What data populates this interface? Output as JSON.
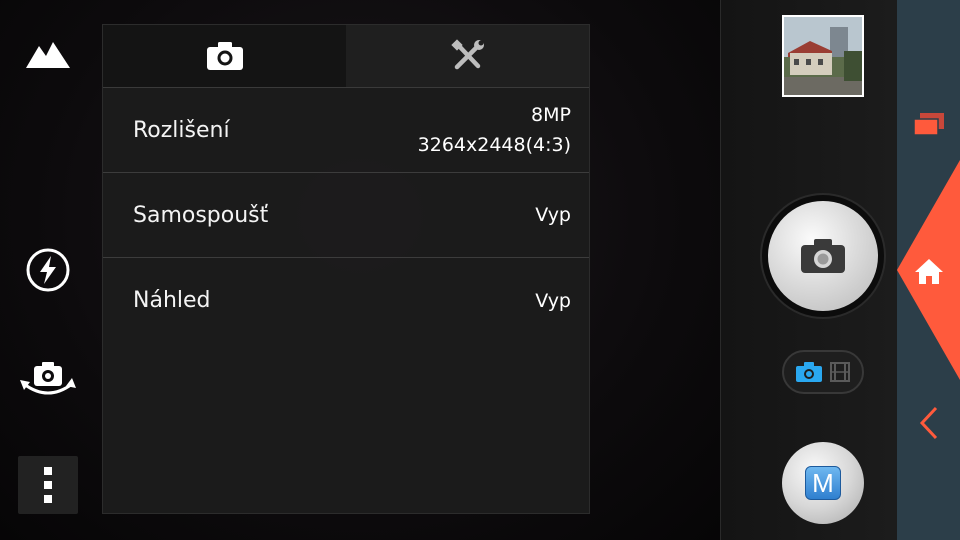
{
  "left_toolbar": {
    "scene_icon": "mountain-icon",
    "flash_icon": "flash-auto-icon",
    "switch_camera_icon": "camera-switch-icon",
    "menu_icon": "more-vert-icon"
  },
  "settings": {
    "tabs": [
      {
        "icon": "camera-icon",
        "active": true
      },
      {
        "icon": "tools-icon",
        "active": false
      }
    ],
    "rows": [
      {
        "label": "Rozlišení",
        "value_line1": "8MP",
        "value_line2": "3264x2448(4:3)"
      },
      {
        "label": "Samospoušť",
        "value_line1": "Vyp"
      },
      {
        "label": "Náhled",
        "value_line1": "Vyp"
      }
    ]
  },
  "right_panel": {
    "thumbnail_icon": "last-photo-thumbnail",
    "shutter_icon": "camera-icon",
    "mode_switch": {
      "photo_icon": "camera-icon",
      "video_icon": "film-icon",
      "active": "photo"
    },
    "manual_label": "M"
  },
  "navigation": {
    "recent_icon": "recent-apps-icon",
    "home_icon": "home-icon",
    "back_icon": "back-icon"
  },
  "colors": {
    "accent_orange": "#ff5a3c",
    "nav_bg": "#2c3e49",
    "mode_active_blue": "#2aa8f0",
    "manual_blue": "#3a8fdc"
  }
}
